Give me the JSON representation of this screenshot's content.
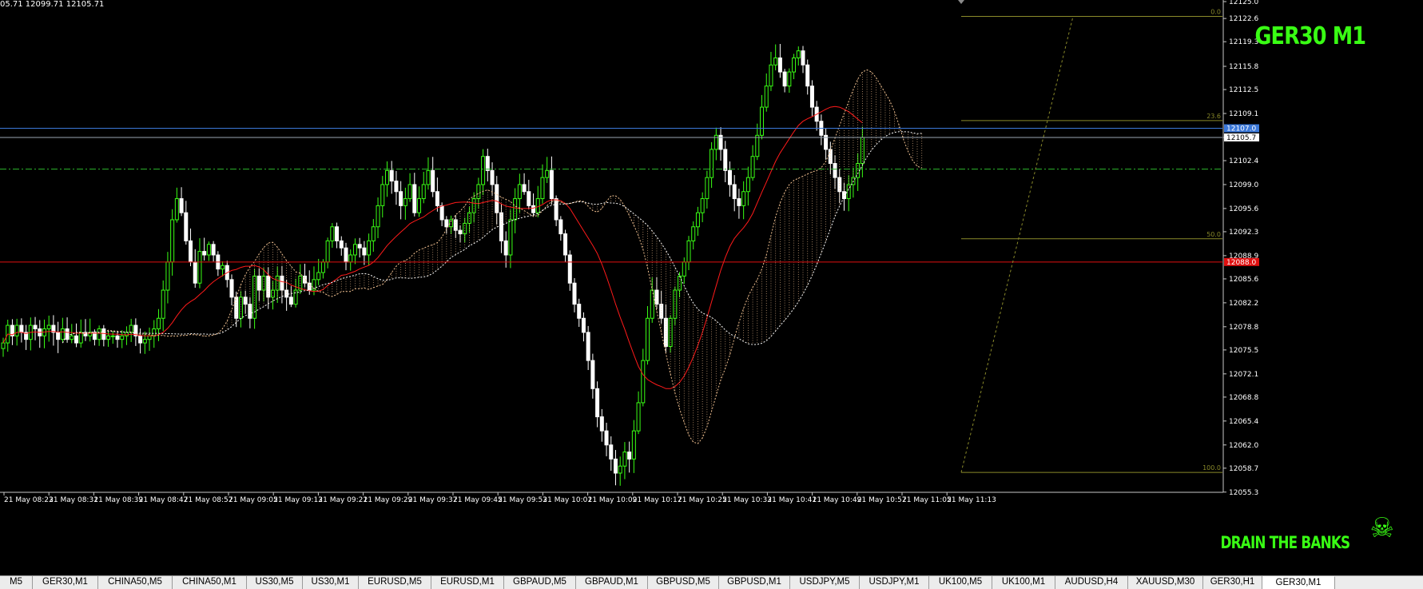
{
  "header": {
    "ohlc_text": "05.71 12099.71 12105.71"
  },
  "title": "GER30 M1",
  "brand": "DRAIN THE BANKS",
  "brand_icon": "skull-crossbones-icon",
  "colors": {
    "background": "#000000",
    "bull": "#39ff14",
    "bear": "#ffffff",
    "ma": "#ff1a1a",
    "cloud": "#f0c090",
    "fib": "#8a8a2a",
    "blue_line": "#3b78d8",
    "red_line": "#e01010",
    "dashdot": "#2db82d"
  },
  "chart_data": {
    "type": "candlestick",
    "symbol": "GER30",
    "timeframe": "M1",
    "ylim": [
      12055.5,
      12125.0
    ],
    "y_ticks": [
      "12125.0",
      "12122.6",
      "12119.3",
      "12115.8",
      "12112.5",
      "12109.1",
      "12105.7",
      "12102.4",
      "12099.0",
      "12095.6",
      "12092.3",
      "12088.9",
      "12085.6",
      "12082.2",
      "12078.8",
      "12075.5",
      "12072.1",
      "12068.8",
      "12065.4",
      "12062.0",
      "12058.7",
      "12055.3"
    ],
    "x_ticks": [
      "21 May 08:23",
      "21 May 08:31",
      "21 May 08:39",
      "21 May 08:47",
      "21 May 08:57",
      "21 May 09:05",
      "21 May 09:13",
      "21 May 09:21",
      "21 May 09:29",
      "21 May 09:37",
      "21 May 09:45",
      "21 May 09:53",
      "21 May 10:01",
      "21 May 10:09",
      "21 May 10:17",
      "21 May 10:25",
      "21 May 10:33",
      "21 May 10:41",
      "21 May 10:49",
      "21 May 10:57",
      "21 May 11:05",
      "21 May 11:13"
    ],
    "closes": [
      12076.5,
      12079.0,
      12077.5,
      12079.0,
      12078.0,
      12077.0,
      12079.0,
      12078.5,
      12077.5,
      12078.5,
      12079.0,
      12078.0,
      12077.0,
      12078.5,
      12077.0,
      12077.5,
      12076.5,
      12078.0,
      12077.5,
      12078.0,
      12077.0,
      12078.5,
      12077.0,
      12077.5,
      12077.5,
      12077.0,
      12077.5,
      12078.0,
      12079.0,
      12077.5,
      12076.5,
      12077.0,
      12077.5,
      12078.5,
      12080.0,
      12084.0,
      12088.0,
      12094.0,
      12097.0,
      12095.0,
      12091.0,
      12088.0,
      12085.0,
      12089.5,
      12089.0,
      12090.5,
      12089.0,
      12087.0,
      12087.5,
      12085.5,
      12083.0,
      12080.0,
      12083.0,
      12082.0,
      12080.0,
      12086.0,
      12084.0,
      12086.0,
      12083.0,
      12084.0,
      12086.0,
      12084.0,
      12083.0,
      12082.0,
      12084.0,
      12086.0,
      12085.0,
      12084.0,
      12085.5,
      12086.5,
      12088.0,
      12091.0,
      12093.0,
      12091.0,
      12090.0,
      12088.0,
      12089.0,
      12090.5,
      12090.0,
      12089.0,
      12091.0,
      12093.0,
      12096.0,
      12099.0,
      12101.0,
      12099.5,
      12098.0,
      12096.0,
      12097.0,
      12099.0,
      12095.0,
      12097.0,
      12099.0,
      12101.0,
      12098.0,
      12096.0,
      12094.0,
      12093.0,
      12094.0,
      12092.5,
      12092.0,
      12093.5,
      12095.0,
      12097.0,
      12099.0,
      12103.0,
      12101.0,
      12099.0,
      12095.0,
      12091.0,
      12089.0,
      12094.0,
      12097.0,
      12099.0,
      12098.0,
      12096.0,
      12095.0,
      12097.0,
      12100.0,
      12101.0,
      12097.0,
      12094.0,
      12092.0,
      12089.0,
      12085.0,
      12082.0,
      12080.0,
      12078.0,
      12074.0,
      12070.0,
      12066.0,
      12064.0,
      12062.0,
      12060.0,
      12058.0,
      12059.0,
      12061.0,
      12060.0,
      12064.0,
      12068.0,
      12074.0,
      12080.0,
      12084.0,
      12082.0,
      12080.0,
      12076.0,
      12080.0,
      12084.0,
      12086.0,
      12088.0,
      12091.0,
      12093.0,
      12095.0,
      12097.0,
      12100.0,
      12104.0,
      12106.0,
      12104.0,
      12101.0,
      12099.0,
      12097.0,
      12096.0,
      12098.0,
      12100.0,
      12103.0,
      12106.0,
      12110.0,
      12113.0,
      12116.0,
      12117.0,
      12115.0,
      12113.0,
      12115.0,
      12117.0,
      12118.0,
      12116.0,
      12113.0,
      12110.0,
      12108.0,
      12106.0,
      12104.0,
      12102.0,
      12100.0,
      12098.0,
      12097.0,
      12099.0,
      12100.0,
      12102.0,
      12105.7
    ],
    "ma_period": 20,
    "fibonacci": [
      {
        "level": "0.0",
        "price": 12122.9
      },
      {
        "level": "23.6",
        "price": 12108.1
      },
      {
        "level": "50.0",
        "price": 12091.3
      },
      {
        "level": "100.0",
        "price": 12058.1
      }
    ],
    "horizontal_lines": [
      {
        "label": "12107.0",
        "price": 12107.0,
        "color": "#3b78d8",
        "tag_bg": "#3b78d8"
      },
      {
        "label": "12105.7",
        "price": 12105.7,
        "color": "#9aa6b2",
        "tag_bg": "#ffffff"
      },
      {
        "label": "12088.0",
        "price": 12088.0,
        "color": "#e01010",
        "tag_bg": "#e01010"
      },
      {
        "label": "",
        "price": 12101.2,
        "color": "#2db82d",
        "tag_bg": ""
      }
    ]
  },
  "tabs": [
    {
      "label": "M5",
      "active": false
    },
    {
      "label": "GER30,M1",
      "active": false
    },
    {
      "label": "CHINA50,M5",
      "active": false
    },
    {
      "label": "CHINA50,M1",
      "active": false
    },
    {
      "label": "US30,M5",
      "active": false
    },
    {
      "label": "US30,M1",
      "active": false
    },
    {
      "label": "EURUSD,M5",
      "active": false
    },
    {
      "label": "EURUSD,M1",
      "active": false
    },
    {
      "label": "GBPAUD,M5",
      "active": false
    },
    {
      "label": "GBPAUD,M1",
      "active": false
    },
    {
      "label": "GBPUSD,M5",
      "active": false
    },
    {
      "label": "GBPUSD,M1",
      "active": false
    },
    {
      "label": "USDJPY,M5",
      "active": false
    },
    {
      "label": "USDJPY,M1",
      "active": false
    },
    {
      "label": "UK100,M5",
      "active": false
    },
    {
      "label": "UK100,M1",
      "active": false
    },
    {
      "label": "AUDUSD,H4",
      "active": false
    },
    {
      "label": "XAUUSD,M30",
      "active": false
    },
    {
      "label": "GER30,H1",
      "active": false
    },
    {
      "label": "GER30,M1",
      "active": true
    }
  ]
}
